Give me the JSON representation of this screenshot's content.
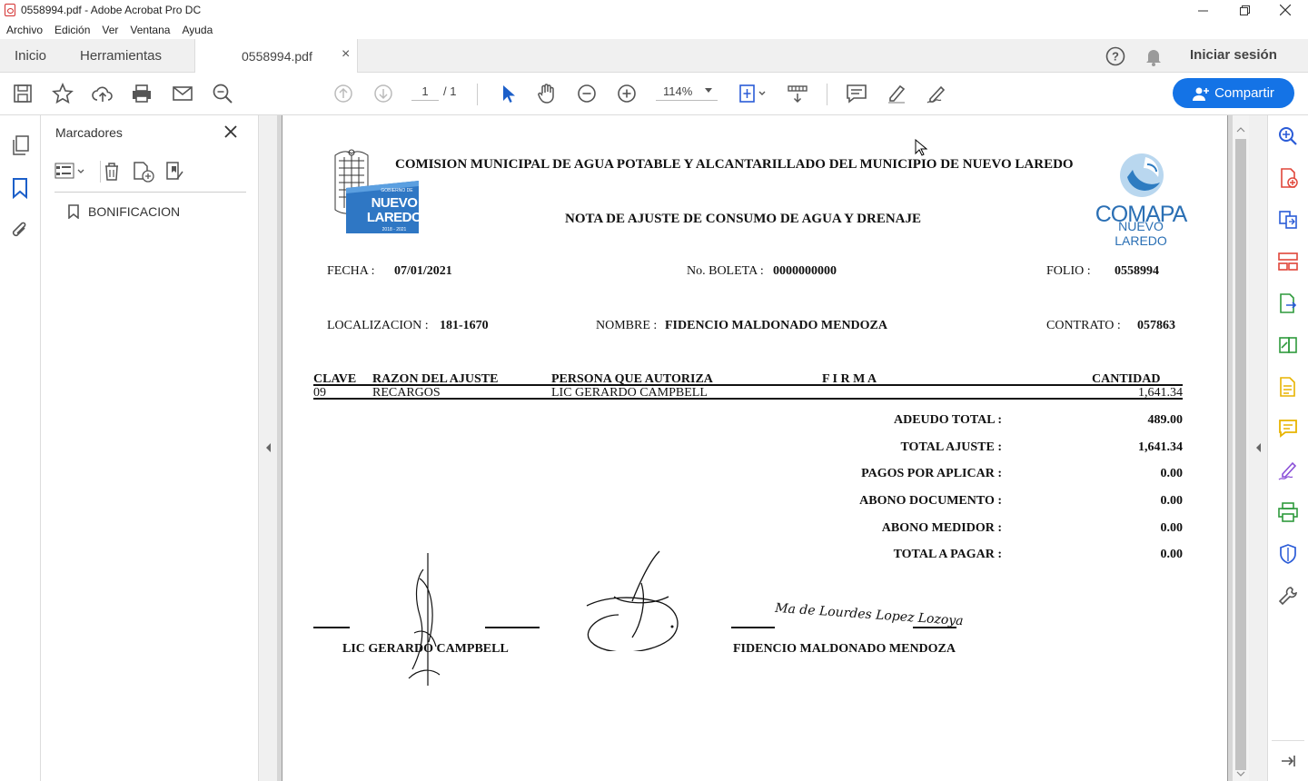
{
  "window": {
    "title": "0558994.pdf - Adobe Acrobat Pro DC",
    "minimize_icon": "minimize-icon",
    "restore_icon": "restore-icon",
    "close_icon": "close-icon"
  },
  "menu": [
    "Archivo",
    "Edición",
    "Ver",
    "Ventana",
    "Ayuda"
  ],
  "tabs": {
    "home": "Inicio",
    "tools": "Herramientas",
    "doc": "0558994.pdf",
    "close": "×"
  },
  "header_right": {
    "signin": "Iniciar sesión"
  },
  "toolbar": {
    "page_current": "1",
    "page_total": "/ 1",
    "zoom": "114%",
    "share": "Compartir"
  },
  "bookmarks": {
    "title": "Marcadores",
    "item": "BONIFICACION"
  },
  "document": {
    "heading": "COMISION MUNICIPAL DE AGUA POTABLE Y ALCANTARILLADO DEL MUNICIPIO DE NUEVO LAREDO",
    "subheading": "NOTA DE AJUSTE DE CONSUMO DE AGUA Y DRENAJE",
    "logo_left_top": "GOBIERNO DE",
    "logo_left_1": "NUEVO",
    "logo_left_2": "LAREDO",
    "logo_left_years": "2018 - 2021",
    "logo_right_1": "COMAPA",
    "logo_right_2": "NUEVO LAREDO",
    "fecha_label": "FECHA :",
    "fecha": "07/01/2021",
    "boleta_label": "No. BOLETA :",
    "boleta": "0000000000",
    "folio_label": "FOLIO :",
    "folio": "0558994",
    "loc_label": "LOCALIZACION :",
    "loc": "181-1670",
    "nombre_label": "NOMBRE :",
    "nombre": "FIDENCIO MALDONADO MENDOZA",
    "contrato_label": "CONTRATO :",
    "contrato": "057863",
    "table_headers": [
      "CLAVE",
      "RAZON DEL AJUSTE",
      "PERSONA QUE AUTORIZA",
      "F I R M A",
      "CANTIDAD"
    ],
    "table_row": [
      "09",
      "RECARGOS",
      "LIC GERARDO CAMPBELL",
      "",
      "1,641.34"
    ],
    "totals": [
      {
        "label": "ADEUDO TOTAL :",
        "value": "489.00"
      },
      {
        "label": "TOTAL AJUSTE :",
        "value": "1,641.34"
      },
      {
        "label": "PAGOS POR APLICAR :",
        "value": "0.00"
      },
      {
        "label": "ABONO DOCUMENTO :",
        "value": "0.00"
      },
      {
        "label": "ABONO MEDIDOR :",
        "value": "0.00"
      },
      {
        "label": "TOTAL A PAGAR :",
        "value": "0.00"
      }
    ],
    "signer_left": "LIC GERARDO CAMPBELL",
    "signer_right": "FIDENCIO MALDONADO MENDOZA",
    "handwritten": "Ma de Lourdes Lopez Lozoya"
  },
  "colors": {
    "accent": "#1473e6",
    "rail_icon_red": "#e0463a",
    "rail_icon_blue": "#2a5bd7",
    "rail_icon_green": "#2e9a3c",
    "rail_icon_yellow": "#e8b400",
    "rail_icon_purple": "#8a4fd8"
  }
}
